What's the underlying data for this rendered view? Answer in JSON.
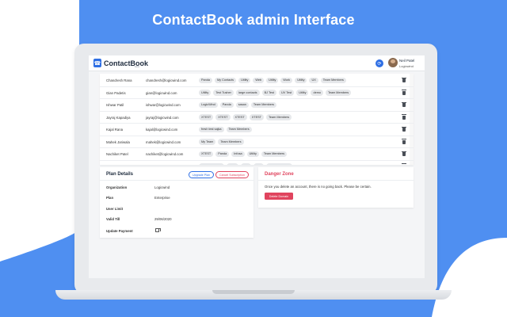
{
  "headline": "ContactBook admin Interface",
  "colors": {
    "brand_blue": "#4f8ff1",
    "accent_blue": "#2f6fe4",
    "danger_red": "#e0445e"
  },
  "app": {
    "logo_text": "ContactBook",
    "logo_sub": "beta",
    "header_icon": "refresh-icon",
    "user_name": "Neil Patel",
    "user_org": "Logicwind"
  },
  "members": [
    {
      "name": "Chandresh Rana",
      "email": "chandresh@logicwind.com",
      "tags": [
        "Panda",
        "My Contacts",
        "Utility",
        "Web",
        "Utility",
        "Work",
        "Utility",
        "UX",
        "Team Members"
      ]
    },
    {
      "name": "Gian Padetis",
      "email": "gian@logicwind.com",
      "tags": [
        "Utility",
        "Test Tusher",
        "large contacts",
        "BJ Test",
        "UV Test",
        "Utility",
        "demo",
        "Team Members"
      ]
    },
    {
      "name": "Ishwar Patil",
      "email": "ishwar@logicwind.com",
      "tags": [
        "LogicWind",
        "Panda",
        "sasan",
        "Team Members"
      ]
    },
    {
      "name": "Jayraj Kapadiya",
      "email": "jayraj@logicwind.com",
      "tags": [
        "XTEST",
        "XTEST",
        "XTEST",
        "XTEST",
        "Team Members"
      ]
    },
    {
      "name": "Kajal Rana",
      "email": "kajal@logicwind.com",
      "tags": [
        "fresh test sajka",
        "Team Members"
      ]
    },
    {
      "name": "Mahek Jariwala",
      "email": "mahek@logicwind.com",
      "tags": [
        "My Team",
        "Team Members"
      ]
    },
    {
      "name": "Nachiket Patel",
      "email": "nachiket@logicwind.com",
      "tags": [
        "XTEST",
        "Panda",
        "Infosa",
        "Utility",
        "Team Members"
      ]
    },
    {
      "name": "Parth Soni",
      "email": "parth@logicwind.com",
      "tags": [
        "Team Members",
        "Utility",
        "Test",
        "Test",
        "Team Members"
      ]
    }
  ],
  "plan": {
    "title": "Plan Details",
    "upgrade_label": "Upgrade Plan",
    "cancel_label": "Cancel Subscription",
    "rows": [
      {
        "label": "Organization",
        "value": "Logicwind"
      },
      {
        "label": "Plan",
        "value": "Enterprise"
      },
      {
        "label": "User Limit",
        "value": ""
      },
      {
        "label": "Valid Till",
        "value": "29/06/2020"
      },
      {
        "label": "Update Payment",
        "value": ""
      }
    ]
  },
  "danger": {
    "title": "Danger Zone",
    "text": "Once you delete an account, there is no going back. Please be certain.",
    "delete_label": "Delete Domain"
  }
}
